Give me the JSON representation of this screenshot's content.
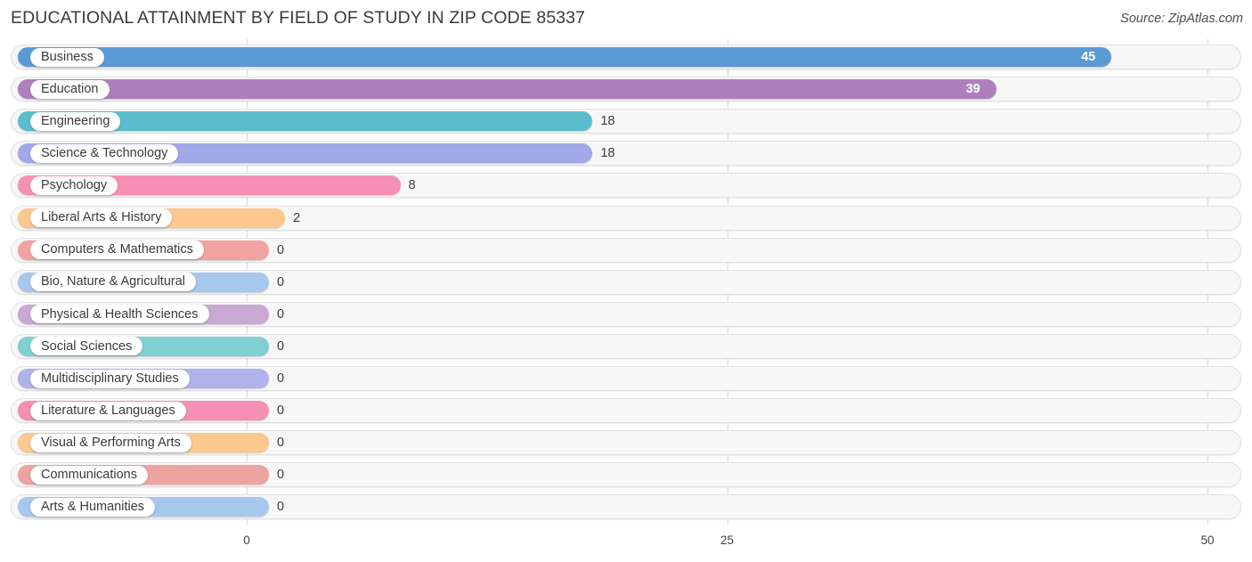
{
  "header": {
    "title": "EDUCATIONAL ATTAINMENT BY FIELD OF STUDY IN ZIP CODE 85337",
    "source": "Source: ZipAtlas.com"
  },
  "chart_data": {
    "type": "bar",
    "orientation": "horizontal",
    "title": "EDUCATIONAL ATTAINMENT BY FIELD OF STUDY IN ZIP CODE 85337",
    "xlabel": "",
    "ylabel": "",
    "xlim": [
      0,
      50
    ],
    "xticks": [
      0,
      25,
      50
    ],
    "xticklabels": [
      "0",
      "25",
      "50"
    ],
    "grid": true,
    "legend": false,
    "categories": [
      "Business",
      "Education",
      "Engineering",
      "Science & Technology",
      "Psychology",
      "Liberal Arts & History",
      "Computers & Mathematics",
      "Bio, Nature & Agricultural",
      "Physical & Health Sciences",
      "Social Sciences",
      "Multidisciplinary Studies",
      "Literature & Languages",
      "Visual & Performing Arts",
      "Communications",
      "Arts & Humanities"
    ],
    "values": [
      45,
      39,
      18,
      18,
      8,
      2,
      0,
      0,
      0,
      0,
      0,
      0,
      0,
      0,
      0
    ],
    "value_labels": [
      "45",
      "39",
      "18",
      "18",
      "8",
      "2",
      "0",
      "0",
      "0",
      "0",
      "0",
      "0",
      "0",
      "0",
      "0"
    ],
    "colors": [
      "#5b9bd5",
      "#ad80bd",
      "#5bbccb",
      "#a0a8e8",
      "#f590b4",
      "#fbc88d",
      "#f1a3a0",
      "#a6c8ec",
      "#c9a8d4",
      "#7ed0d2",
      "#aeb4ea",
      "#f58fb4",
      "#fbc88d",
      "#eda3a0",
      "#a6c8ec"
    ]
  }
}
